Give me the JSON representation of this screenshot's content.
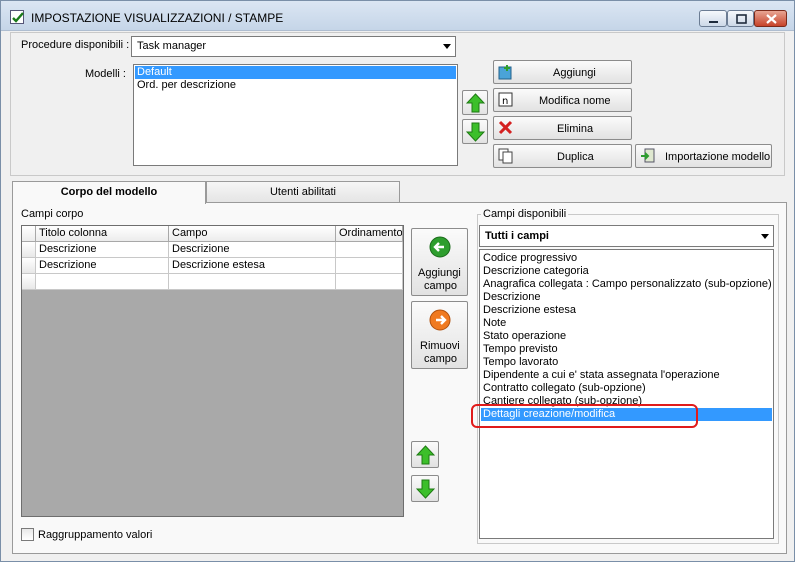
{
  "window": {
    "title": "IMPOSTAZIONE VISUALIZZAZIONI / STAMPE",
    "controls": [
      "minimize-icon",
      "maximize-icon",
      "close-icon"
    ]
  },
  "top": {
    "procedure_label": "Procedure disponibili :",
    "procedure_value": "Task manager",
    "modelli_label": "Modelli :",
    "modelli": [
      {
        "label": "Default",
        "selected": true
      },
      {
        "label": "Ord. per descrizione",
        "selected": false
      }
    ],
    "buttons": {
      "aggiungi": "Aggiungi",
      "modifica_nome": "Modifica nome",
      "elimina": "Elimina",
      "duplica": "Duplica",
      "importazione": "Importazione modello"
    }
  },
  "tabs": [
    {
      "label": "Corpo del modello",
      "active": true
    },
    {
      "label": "Utenti abilitati",
      "active": false
    }
  ],
  "corpo": {
    "campi_corpo_label": "Campi corpo",
    "columns": [
      "Titolo colonna",
      "Campo",
      "Ordinamento"
    ],
    "rows": [
      [
        "Descrizione",
        "Descrizione",
        ""
      ],
      [
        "Descrizione",
        "Descrizione estesa",
        ""
      ],
      [
        "",
        "",
        ""
      ]
    ],
    "aggiungi_campo": [
      "Aggiungi",
      "campo"
    ],
    "rimuovi_campo": [
      "Rimuovi",
      "campo"
    ],
    "raggruppamento_label": "Raggruppamento valori",
    "raggruppamento_checked": false
  },
  "disponibili": {
    "label": "Campi disponibili",
    "filter_value": "Tutti i campi",
    "items": [
      {
        "label": "Codice progressivo",
        "selected": false
      },
      {
        "label": "Descrizione categoria",
        "selected": false
      },
      {
        "label": "Anagrafica collegata : Campo personalizzato (sub-opzione)",
        "selected": false
      },
      {
        "label": "Descrizione",
        "selected": false
      },
      {
        "label": "Descrizione estesa",
        "selected": false
      },
      {
        "label": "Note",
        "selected": false
      },
      {
        "label": "Stato operazione",
        "selected": false
      },
      {
        "label": "Tempo previsto",
        "selected": false
      },
      {
        "label": "Tempo lavorato",
        "selected": false
      },
      {
        "label": "Dipendente a cui e' stata assegnata l'operazione",
        "selected": false
      },
      {
        "label": "Contratto collegato (sub-opzione)",
        "selected": false
      },
      {
        "label": "Cantiere collegato (sub-opzione)",
        "selected": false
      },
      {
        "label": "Dettagli creazione/modifica",
        "selected": true
      }
    ]
  },
  "colors": {
    "selection": "#3399ff",
    "annotation": "#e01b1b",
    "arrow_green": "#3cbf2a",
    "add_green": "#2e9e2e",
    "remove_orange": "#f07a20"
  }
}
